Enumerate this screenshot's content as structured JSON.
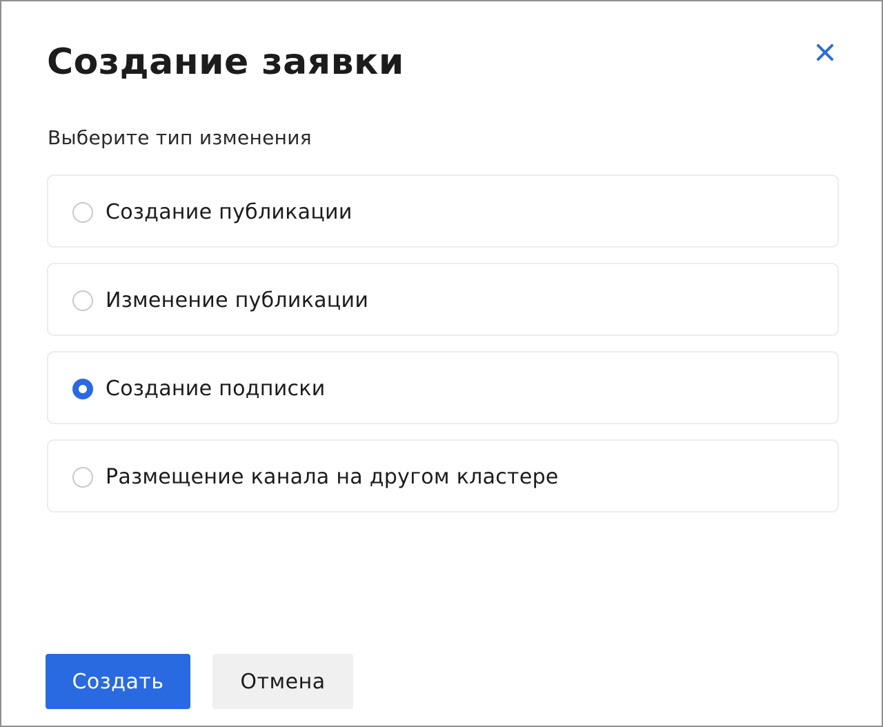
{
  "dialog": {
    "title": "Создание заявки",
    "close_icon": "close-icon",
    "subtitle": "Выберите тип изменения",
    "options": [
      {
        "label": "Создание публикации",
        "selected": false
      },
      {
        "label": "Изменение публикации",
        "selected": false
      },
      {
        "label": "Создание подписки",
        "selected": true
      },
      {
        "label": "Размещение канала на другом кластере",
        "selected": false
      }
    ],
    "buttons": {
      "create_label": "Создать",
      "cancel_label": "Отмена"
    },
    "colors": {
      "accent": "#2a6ae0",
      "text": "#1c1c1c",
      "secondary_button_bg": "#f0f0f0",
      "option_border": "#ececec",
      "radio_border": "#c8c8c8"
    }
  }
}
